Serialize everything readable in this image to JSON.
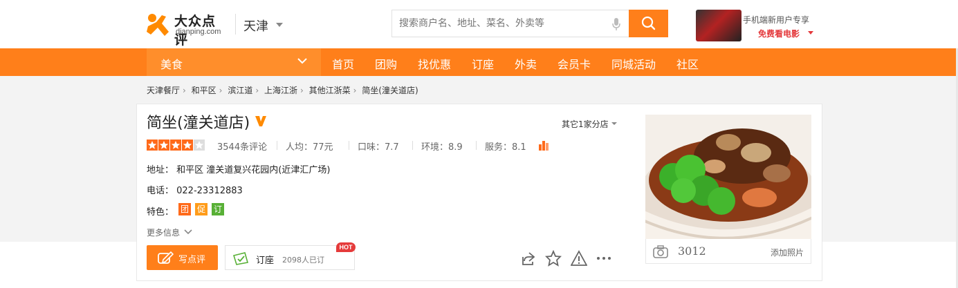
{
  "header": {
    "logo_cn": "大众点评",
    "logo_en": "dianping.com",
    "city": "天津",
    "search_placeholder": "搜索商户名、地址、菜名、外卖等",
    "promo_line1": "手机端新用户专享",
    "promo_line2": "免费看电影"
  },
  "nav": {
    "category": "美食",
    "items": [
      "首页",
      "团购",
      "找优惠",
      "订座",
      "外卖",
      "会员卡",
      "同城活动",
      "社区"
    ]
  },
  "breadcrumb": [
    "天津餐厅",
    "和平区",
    "滨江道",
    "上海江浙",
    "其他江浙菜",
    "简坐(潼关道店)"
  ],
  "breadcrumb_sep": "›",
  "shop": {
    "name": "简坐(潼关道店)",
    "branches": "其它1家分店",
    "star_rating": 4,
    "star_max": 5,
    "review_count": "3544条评论",
    "avg_price": "人均：77元",
    "taste": "口味：7.7",
    "environment": "环境：8.9",
    "service": "服务：8.1",
    "address": "地址： 和平区 潼关道复兴花园内(近津汇广场)",
    "phone": "电话： 022-23312883",
    "features_label": "特色：",
    "tags": [
      {
        "text": "团",
        "color": "#ff6a1a"
      },
      {
        "text": "促",
        "color": "#ff9c1a"
      },
      {
        "text": "订",
        "color": "#58b036"
      }
    ],
    "more_info": "更多信息"
  },
  "actions": {
    "write_review": "写点评",
    "book": "订座",
    "book_count": "2098人已订",
    "hot": "HOT"
  },
  "photo": {
    "count": "3012",
    "add": "添加照片"
  },
  "colors": {
    "accent": "#ff7f1a",
    "star": "#ff6a1a"
  }
}
